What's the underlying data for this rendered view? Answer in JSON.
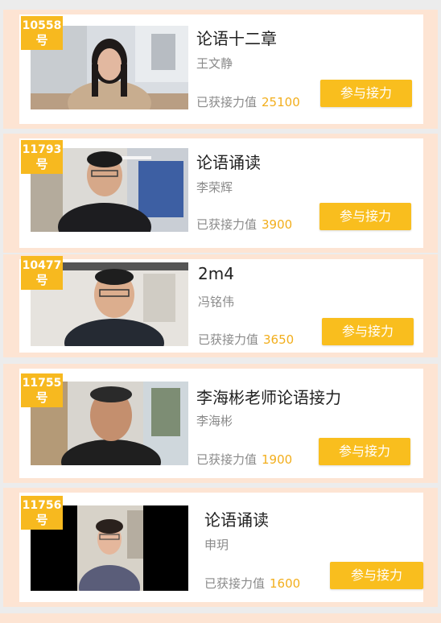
{
  "cards": [
    {
      "number": "10558",
      "hao": "号",
      "title": "论语十二章",
      "author": "王文静",
      "relay_label": "已获接力值",
      "relay_value": "25100",
      "button_label": "参与接力"
    },
    {
      "number": "11793",
      "hao": "号",
      "title": "论语诵读",
      "author": "李荣辉",
      "relay_label": "已获接力值",
      "relay_value": "3900",
      "button_label": "参与接力"
    },
    {
      "number": "10477",
      "hao": "号",
      "title": "2m4",
      "author": "冯铭伟",
      "relay_label": "已获接力值",
      "relay_value": "3650",
      "button_label": "参与接力"
    },
    {
      "number": "11755",
      "hao": "号",
      "title": "李海彬老师论语接力",
      "author": "李海彬",
      "relay_label": "已获接力值",
      "relay_value": "1900",
      "button_label": "参与接力"
    },
    {
      "number": "11756",
      "hao": "号",
      "title": "论语诵读",
      "author": "申玥",
      "relay_label": "已获接力值",
      "relay_value": "1600",
      "button_label": "参与接力"
    }
  ],
  "colors": {
    "badge": "#f7b91f",
    "button": "#f9be1e",
    "relay_value": "#f2ae1c",
    "card_border": "#fde4d3"
  }
}
